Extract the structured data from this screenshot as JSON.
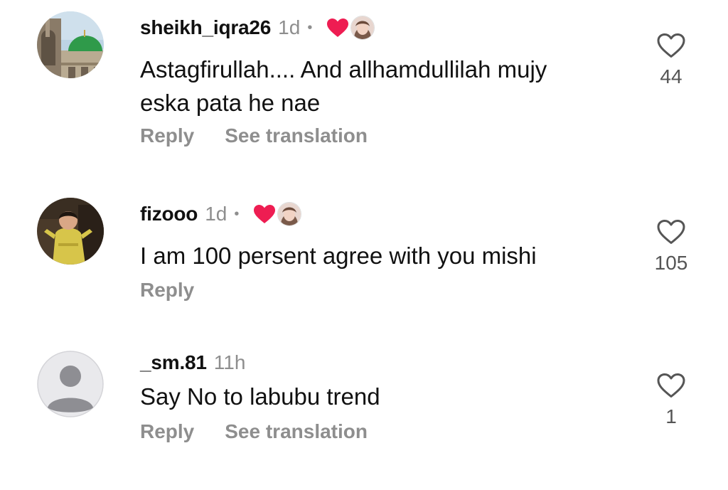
{
  "comments": [
    {
      "username": "sheikh_iqra26",
      "age": "1d",
      "dot": "•",
      "text": "Astagfirullah.... And allhamdullilah mujy eska pata he nae",
      "reply_label": "Reply",
      "translate_label": "See translation",
      "like_count": "44",
      "avatar_icon": "mosque-dome-avatar",
      "creator_liked": true
    },
    {
      "username": "fizooo",
      "age": "1d",
      "dot": "•",
      "text": "I am 100 persent agree with you mishi",
      "reply_label": "Reply",
      "like_count": "105",
      "avatar_icon": "child-photo-avatar",
      "creator_liked": true
    },
    {
      "username": "_sm.81",
      "age": "11h",
      "text": "Say No to labubu trend",
      "reply_label": "Reply",
      "translate_label": "See translation",
      "like_count": "1",
      "avatar_icon": "default-person-avatar",
      "creator_liked": false
    }
  ],
  "colors": {
    "heart_red": "#ee1d52",
    "muted": "#8e8e8e"
  }
}
